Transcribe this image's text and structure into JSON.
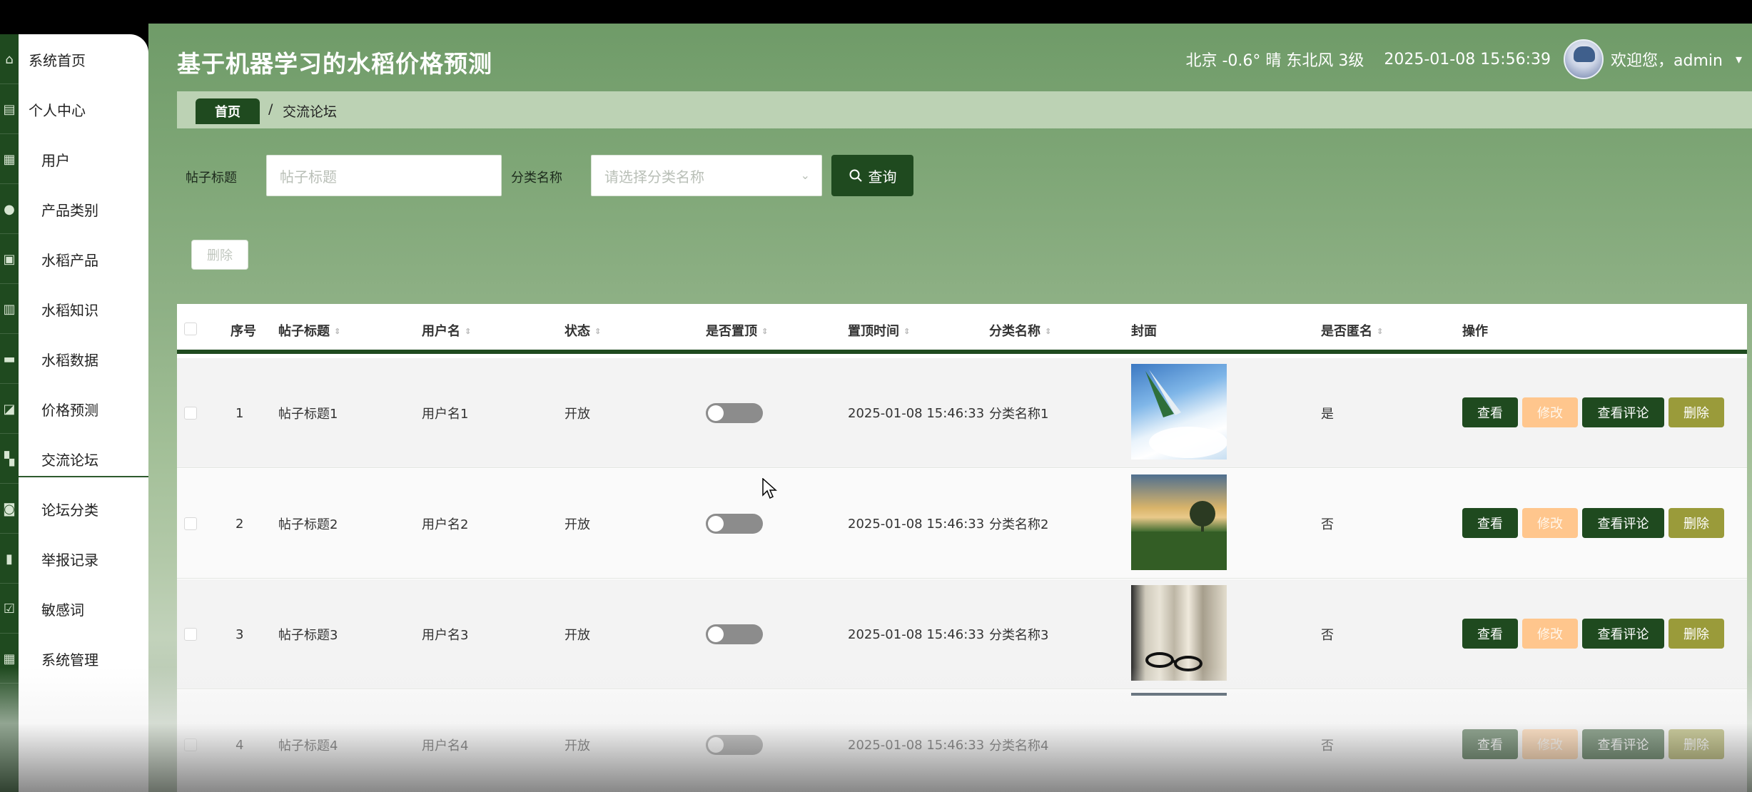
{
  "header": {
    "app_title": "基于机器学习的水稻价格预测",
    "weather": "北京 -0.6° 晴 东北风 3级",
    "datetime": "2025-01-08 15:56:39",
    "welcome": "欢迎您，admin",
    "caret_icon": "caret-down-icon"
  },
  "sidebar": {
    "items": [
      {
        "label": "系统首页",
        "icon": "home-icon"
      },
      {
        "label": "个人中心",
        "icon": "profile-icon"
      },
      {
        "label": "用户",
        "icon": "grid-icon"
      },
      {
        "label": "产品类别",
        "icon": "user-icon"
      },
      {
        "label": "水稻产品",
        "icon": "briefcase-icon"
      },
      {
        "label": "水稻知识",
        "icon": "clipboard-icon"
      },
      {
        "label": "水稻数据",
        "icon": "monitor-icon"
      },
      {
        "label": "价格预测",
        "icon": "chart-icon"
      },
      {
        "label": "交流论坛",
        "icon": "apps-icon"
      },
      {
        "label": "论坛分类",
        "icon": "tag-icon"
      },
      {
        "label": "举报记录",
        "icon": "bar-chart-icon"
      },
      {
        "label": "敏感词",
        "icon": "check-icon"
      },
      {
        "label": "系统管理",
        "icon": "settings-grid-icon"
      }
    ]
  },
  "breadcrumb": {
    "home": "首页",
    "separator": "/",
    "current": "交流论坛"
  },
  "search": {
    "title_label": "帖子标题",
    "title_placeholder": "帖子标题",
    "category_label": "分类名称",
    "category_placeholder": "请选择分类名称",
    "query_label": "查询",
    "delete_label": "删除"
  },
  "table": {
    "headers": {
      "index": "序号",
      "title": "帖子标题",
      "username": "用户名",
      "status": "状态",
      "pinned": "是否置顶",
      "pin_time": "置顶时间",
      "category": "分类名称",
      "cover": "封面",
      "anonymous": "是否匿名",
      "actions": "操作"
    },
    "actions": {
      "view": "查看",
      "edit": "修改",
      "comments": "查看评论",
      "delete": "删除"
    },
    "rows": [
      {
        "index": "1",
        "title": "帖子标题1",
        "username": "用户名1",
        "status": "开放",
        "pinned": false,
        "pin_time": "2025-01-08 15:46:33",
        "category": "分类名称1",
        "anonymous": "是"
      },
      {
        "index": "2",
        "title": "帖子标题2",
        "username": "用户名2",
        "status": "开放",
        "pinned": false,
        "pin_time": "2025-01-08 15:46:33",
        "category": "分类名称2",
        "anonymous": "否"
      },
      {
        "index": "3",
        "title": "帖子标题3",
        "username": "用户名3",
        "status": "开放",
        "pinned": false,
        "pin_time": "2025-01-08 15:46:33",
        "category": "分类名称3",
        "anonymous": "否"
      },
      {
        "index": "4",
        "title": "帖子标题4",
        "username": "用户名4",
        "status": "开放",
        "pinned": false,
        "pin_time": "2025-01-08 15:46:33",
        "category": "分类名称4",
        "anonymous": "否"
      }
    ]
  },
  "colors": {
    "brand_dark_green": "#1f4a1f",
    "header_green": "#6f9b68",
    "edit_orange": "#ffc68d",
    "delete_olive": "#9a9b3a"
  }
}
